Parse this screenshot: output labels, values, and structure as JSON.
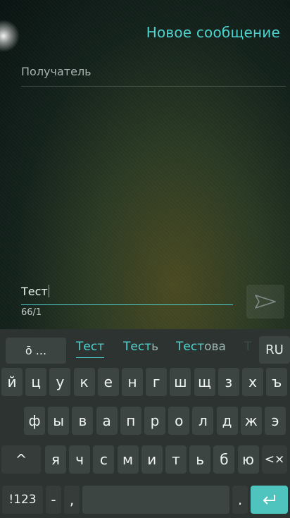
{
  "header": {
    "title": "Новое сообщение"
  },
  "recipient": {
    "placeholder": "Получатель"
  },
  "message": {
    "text": "Тест",
    "counter": "66/1"
  },
  "keyboard": {
    "clipboard_label": "ō ...",
    "suggestions": [
      {
        "typed": "Тест",
        "rest": ""
      },
      {
        "typed": "Тест",
        "rest": "ь"
      },
      {
        "typed": "Тест",
        "rest": "ова"
      },
      {
        "typed": "Т",
        "rest": ""
      }
    ],
    "language": "RU",
    "rows": [
      [
        "й",
        "ц",
        "у",
        "к",
        "е",
        "н",
        "г",
        "ш",
        "щ",
        "з",
        "х",
        "ъ"
      ],
      [
        "ф",
        "ы",
        "в",
        "а",
        "п",
        "р",
        "о",
        "л",
        "д",
        "ж",
        "э"
      ],
      [
        "^",
        "я",
        "ч",
        "с",
        "м",
        "и",
        "т",
        "ь",
        "б",
        "ю",
        "<×"
      ]
    ],
    "bottom": {
      "symbols": "!123",
      "dash": "-",
      "comma": ",",
      "period": "."
    }
  },
  "colors": {
    "accent": "#4fd3cf",
    "keyboard_bg": "#2d3331",
    "key_bg": "#3d4542"
  }
}
